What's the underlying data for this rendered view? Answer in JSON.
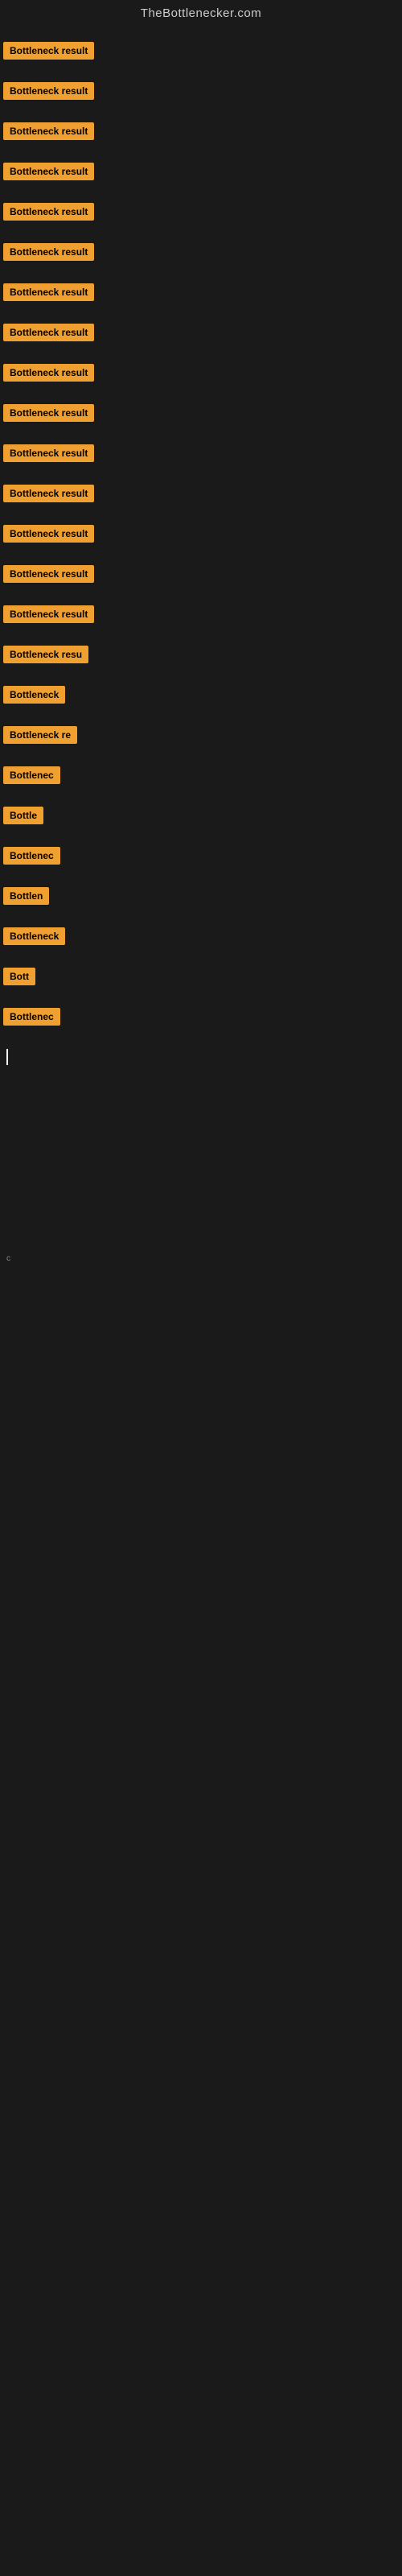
{
  "header": {
    "title": "TheBottlenecker.com"
  },
  "accent_color": "#f0a030",
  "rows": [
    {
      "id": 1,
      "label": "Bottleneck result",
      "width": 130,
      "visible": true
    },
    {
      "id": 2,
      "label": "Bottleneck result",
      "width": 130,
      "visible": true
    },
    {
      "id": 3,
      "label": "Bottleneck result",
      "width": 130,
      "visible": true
    },
    {
      "id": 4,
      "label": "Bottleneck result",
      "width": 130,
      "visible": true
    },
    {
      "id": 5,
      "label": "Bottleneck result",
      "width": 130,
      "visible": true
    },
    {
      "id": 6,
      "label": "Bottleneck result",
      "width": 130,
      "visible": true
    },
    {
      "id": 7,
      "label": "Bottleneck result",
      "width": 130,
      "visible": true
    },
    {
      "id": 8,
      "label": "Bottleneck result",
      "width": 130,
      "visible": true
    },
    {
      "id": 9,
      "label": "Bottleneck result",
      "width": 130,
      "visible": true
    },
    {
      "id": 10,
      "label": "Bottleneck result",
      "width": 130,
      "visible": true
    },
    {
      "id": 11,
      "label": "Bottleneck result",
      "width": 130,
      "visible": true
    },
    {
      "id": 12,
      "label": "Bottleneck result",
      "width": 130,
      "visible": true
    },
    {
      "id": 13,
      "label": "Bottleneck result",
      "width": 130,
      "visible": true
    },
    {
      "id": 14,
      "label": "Bottleneck result",
      "width": 130,
      "visible": true
    },
    {
      "id": 15,
      "label": "Bottleneck result",
      "width": 130,
      "visible": true
    },
    {
      "id": 16,
      "label": "Bottleneck resu",
      "width": 110,
      "visible": true
    },
    {
      "id": 17,
      "label": "Bottleneck",
      "width": 80,
      "visible": true
    },
    {
      "id": 18,
      "label": "Bottleneck re",
      "width": 95,
      "visible": true
    },
    {
      "id": 19,
      "label": "Bottlenec",
      "width": 72,
      "visible": true
    },
    {
      "id": 20,
      "label": "Bottle",
      "width": 52,
      "visible": true
    },
    {
      "id": 21,
      "label": "Bottlenec",
      "width": 72,
      "visible": true
    },
    {
      "id": 22,
      "label": "Bottlen",
      "width": 60,
      "visible": true
    },
    {
      "id": 23,
      "label": "Bottleneck",
      "width": 80,
      "visible": true
    },
    {
      "id": 24,
      "label": "Bott",
      "width": 40,
      "visible": true
    },
    {
      "id": 25,
      "label": "Bottlenec",
      "width": 72,
      "visible": true
    }
  ],
  "cursor": {
    "visible": true,
    "row": 26
  },
  "footer_text": "c"
}
